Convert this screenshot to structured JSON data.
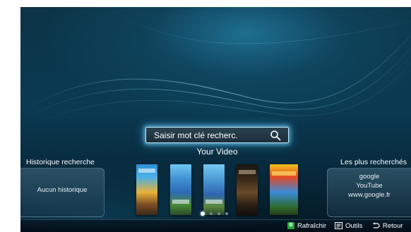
{
  "search": {
    "placeholder_text": "Saisir mot clé recherc."
  },
  "section_title": "Your Video",
  "history": {
    "title": "Historique recherche",
    "empty_text": "Aucun historique"
  },
  "popular": {
    "title": "Les plus recherchés",
    "items": [
      "google",
      "YouTube",
      "www.google.fr"
    ]
  },
  "posters": [
    "poster-1",
    "poster-2",
    "poster-3",
    "poster-4",
    "poster-5"
  ],
  "pagination": {
    "total_pages": 4,
    "current_page": 1
  },
  "bottom_bar": {
    "refresh_key": "B",
    "refresh_label": "Rafraîchir",
    "tools_label": "Outils",
    "back_label": "Retour"
  },
  "colors": {
    "accent_glow": "#6ec8f0",
    "green_key": "#25a83a",
    "background": "#0a3a52"
  }
}
